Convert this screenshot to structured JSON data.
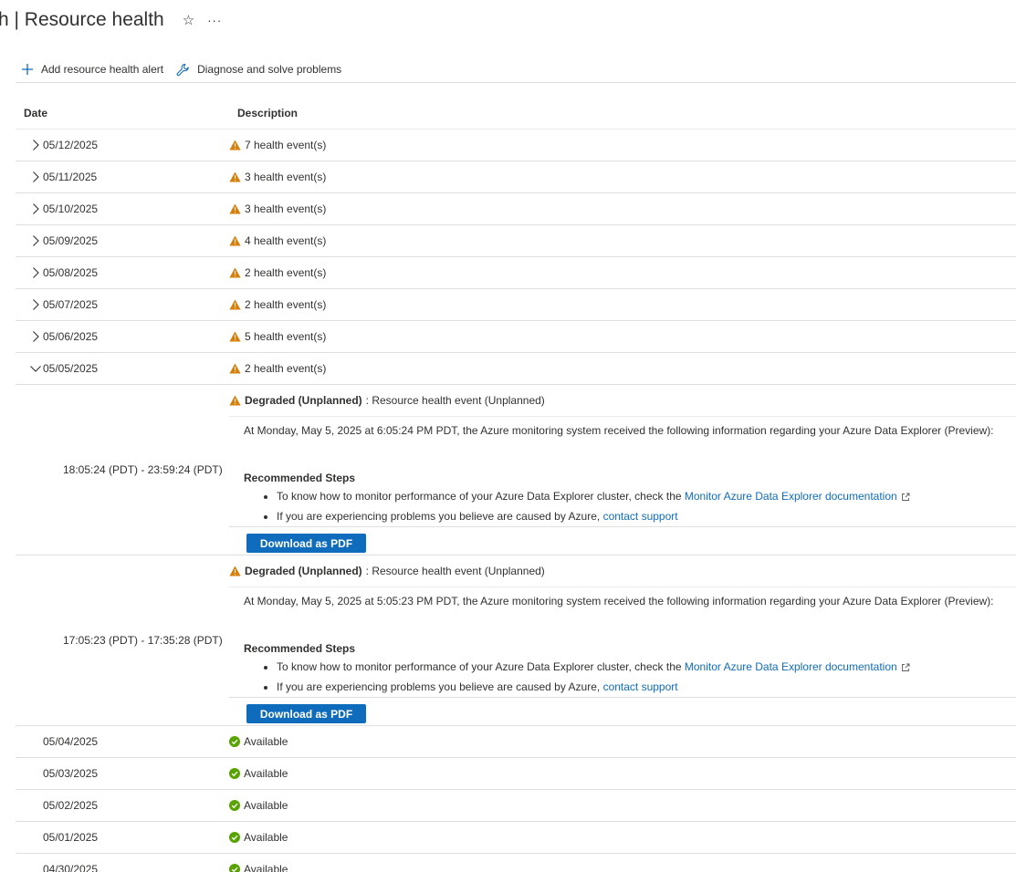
{
  "header": {
    "title": "h | Resource health",
    "star": "☆",
    "more": "···"
  },
  "toolbar": {
    "add_alert": "Add resource health alert",
    "diagnose": "Diagnose and solve problems"
  },
  "grid": {
    "columns": {
      "date": "Date",
      "description": "Description"
    },
    "collapsed_rows": [
      {
        "date": "05/12/2025",
        "desc": "7 health event(s)"
      },
      {
        "date": "05/11/2025",
        "desc": "3 health event(s)"
      },
      {
        "date": "05/10/2025",
        "desc": "3 health event(s)"
      },
      {
        "date": "05/09/2025",
        "desc": "4 health event(s)"
      },
      {
        "date": "05/08/2025",
        "desc": "2 health event(s)"
      },
      {
        "date": "05/07/2025",
        "desc": "2 health event(s)"
      },
      {
        "date": "05/06/2025",
        "desc": "5 health event(s)"
      }
    ],
    "expanded_row": {
      "date": "05/05/2025",
      "desc": "2 health event(s)"
    },
    "events": [
      {
        "range": "18:05:24 (PDT) - 23:59:24 (PDT)",
        "status": "Degraded (Unplanned)",
        "title_suffix": ": Resource health event (Unplanned)",
        "info": "At Monday, May 5, 2025 at 6:05:24 PM PDT, the Azure monitoring system received the following information regarding your Azure Data Explorer (Preview):",
        "recommended": "Recommended Steps",
        "step1_text": "To know how to monitor performance of your Azure Data Explorer cluster, check the",
        "step1_link": "Monitor Azure Data Explorer documentation",
        "step2_text": "If you are experiencing problems you believe are caused by Azure,",
        "step2_link": "contact support",
        "button": "Download as PDF"
      },
      {
        "range": "17:05:23 (PDT) - 17:35:28 (PDT)",
        "status": "Degraded (Unplanned)",
        "title_suffix": ": Resource health event (Unplanned)",
        "info": "At Monday, May 5, 2025 at 5:05:23 PM PDT, the Azure monitoring system received the following information regarding your Azure Data Explorer (Preview):",
        "recommended": "Recommended Steps",
        "step1_text": "To know how to monitor performance of your Azure Data Explorer cluster, check the",
        "step1_link": "Monitor Azure Data Explorer documentation",
        "step2_text": "If you are experiencing problems you believe are caused by Azure,",
        "step2_link": "contact support",
        "button": "Download as PDF"
      }
    ],
    "available_rows": [
      {
        "date": "05/04/2025",
        "desc": "Available"
      },
      {
        "date": "05/03/2025",
        "desc": "Available"
      },
      {
        "date": "05/02/2025",
        "desc": "Available"
      },
      {
        "date": "05/01/2025",
        "desc": "Available"
      },
      {
        "date": "04/30/2025",
        "desc": "Available"
      }
    ]
  },
  "colors": {
    "accent": "#0f6cbd",
    "warning": "#d67f0b",
    "ok": "#57a300"
  }
}
